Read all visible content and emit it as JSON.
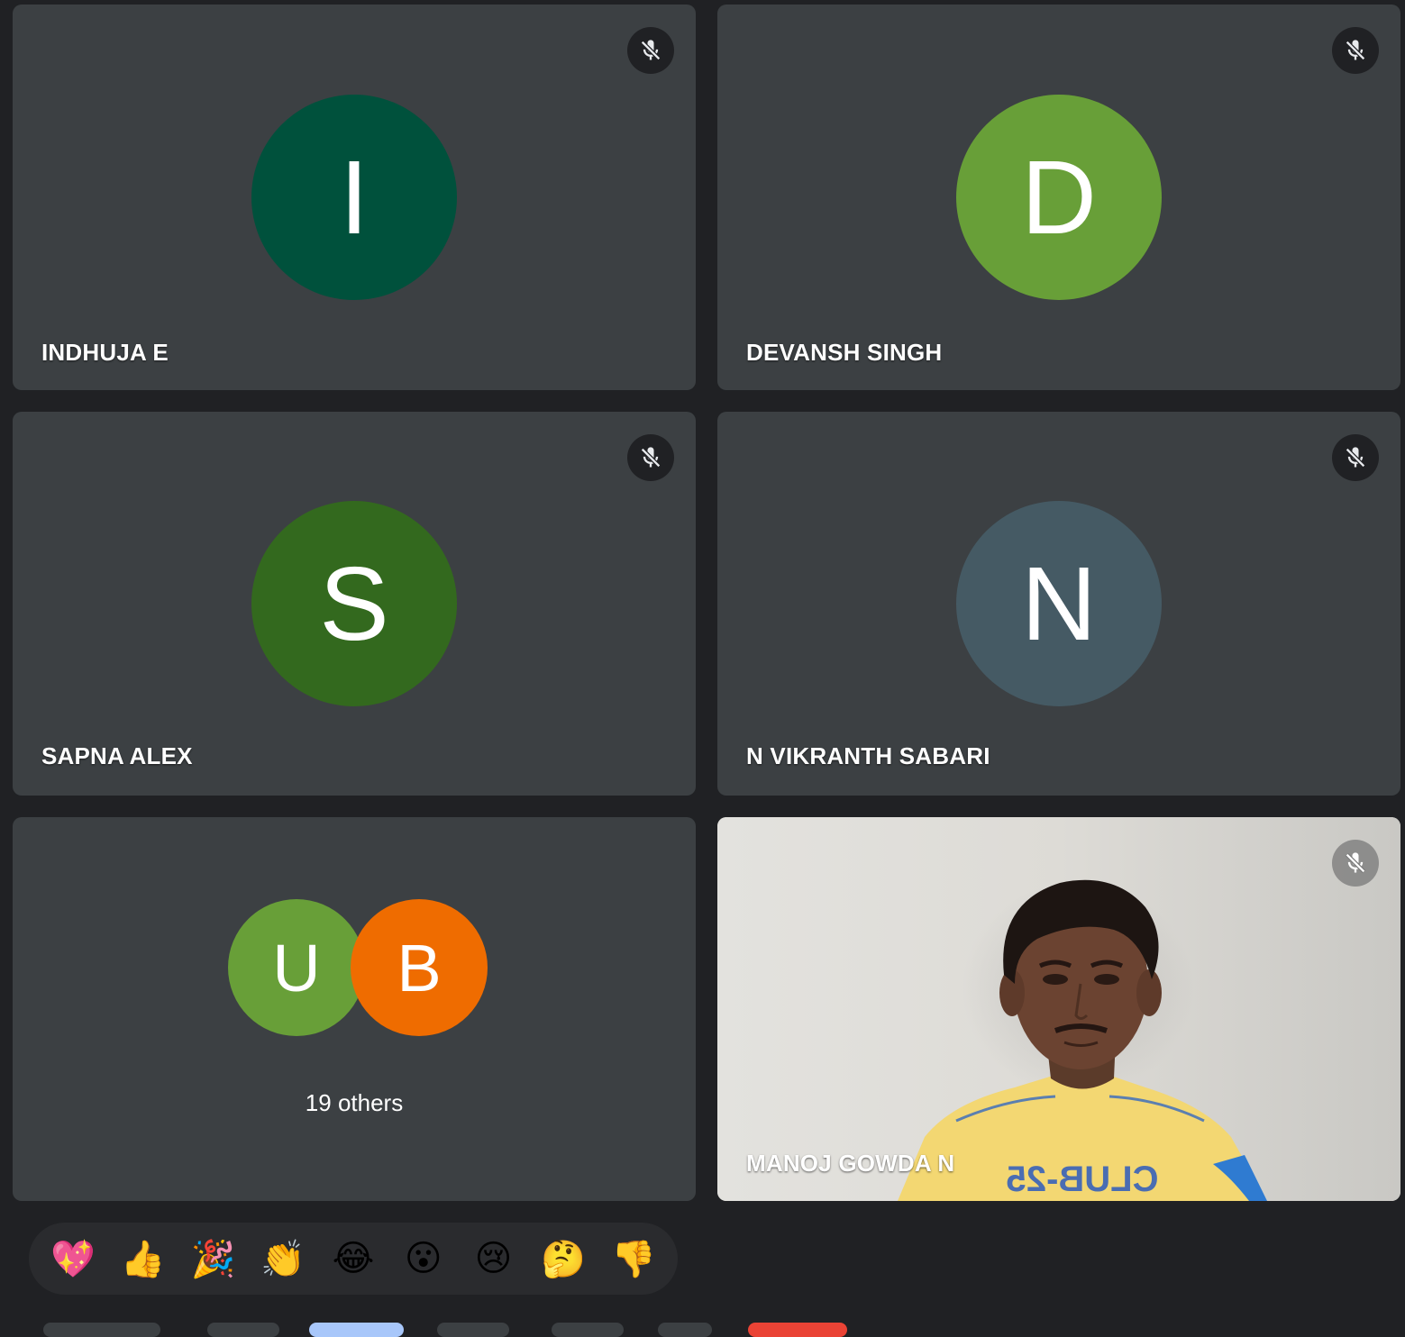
{
  "participants": [
    {
      "name": "INDHUJA E",
      "initial": "I",
      "color": "#00513c"
    },
    {
      "name": "DEVANSH SINGH",
      "initial": "D",
      "color": "#689f38"
    },
    {
      "name": "SAPNA ALEX",
      "initial": "S",
      "color": "#33691e"
    },
    {
      "name": "N VIKRANTH SABARI",
      "initial": "N",
      "color": "#455a64"
    }
  ],
  "others": {
    "avatars": [
      {
        "initial": "U",
        "color": "#689f38"
      },
      {
        "initial": "B",
        "color": "#ef6c00"
      }
    ],
    "label": "19 others"
  },
  "video_participant": {
    "name": "MANOJ GOWDA N",
    "shirt_text": "CLUB-25"
  },
  "mute_icon": "mic-off-icon",
  "reactions": [
    {
      "name": "sparkling-heart",
      "glyph": "💖"
    },
    {
      "name": "thumbs-up",
      "glyph": "👍"
    },
    {
      "name": "party-popper",
      "glyph": "🎉"
    },
    {
      "name": "clapping-hands",
      "glyph": "👏"
    },
    {
      "name": "tears-of-joy",
      "glyph": "😂"
    },
    {
      "name": "surprised",
      "glyph": "😮"
    },
    {
      "name": "crying",
      "glyph": "😢"
    },
    {
      "name": "thinking",
      "glyph": "🤔"
    },
    {
      "name": "thumbs-down",
      "glyph": "👎"
    }
  ]
}
